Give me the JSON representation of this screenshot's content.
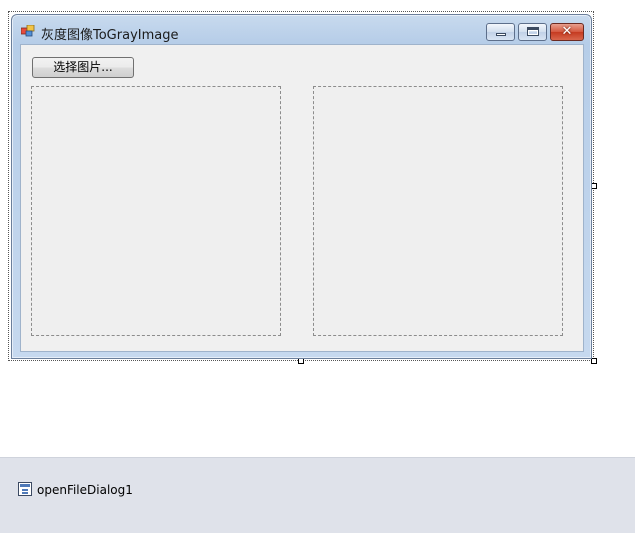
{
  "window": {
    "title": "灰度图像ToGrayImage",
    "caption_buttons": {
      "minimize_icon": "minimize-icon",
      "maximize_icon": "maximize-icon",
      "close_glyph": "✕"
    }
  },
  "form": {
    "select_button_label": "选择图片...",
    "picture_boxes": [
      "original-picture-box",
      "gray-picture-box"
    ]
  },
  "component_tray": {
    "items": [
      {
        "label": "openFileDialog1",
        "icon": "dialog-component-icon"
      }
    ]
  },
  "colors": {
    "title_bar": "#c8daee",
    "client_background": "#f0f0f0",
    "close_button": "#c53a20",
    "tray_background": "#dfe2ea"
  }
}
